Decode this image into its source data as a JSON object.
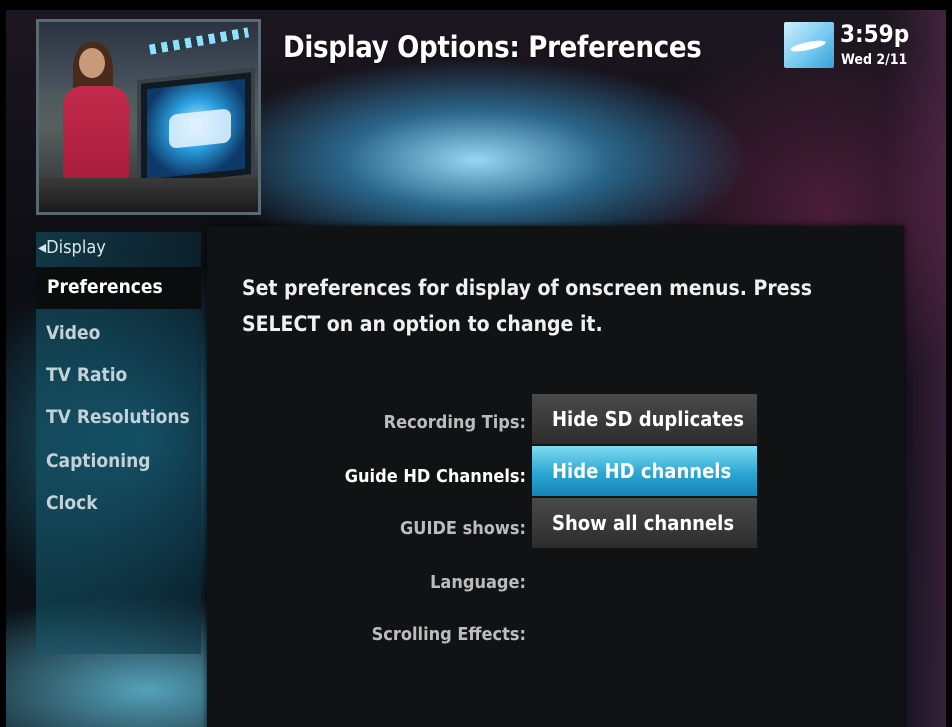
{
  "header": {
    "title": "Display Options: Preferences",
    "time": "3:59p",
    "date": "Wed 2/11"
  },
  "sidebar": {
    "back_label": "Display",
    "items": [
      {
        "label": "Preferences",
        "selected": true
      },
      {
        "label": "Video"
      },
      {
        "label": "TV Ratio"
      },
      {
        "label": "TV Resolutions"
      },
      {
        "label": "Captioning"
      },
      {
        "label": "Clock"
      }
    ]
  },
  "main": {
    "intro": "Set preferences for display of onscreen menus. Press SELECT on an option to change it.",
    "options": [
      {
        "label": "Recording Tips:",
        "value": "Hide SD duplicates"
      },
      {
        "label": "Guide HD Channels:",
        "value": "Hide HD channels",
        "focused": true
      },
      {
        "label": "GUIDE shows:",
        "value": "Show all channels"
      },
      {
        "label": "Language:",
        "value": ""
      },
      {
        "label": "Scrolling Effects:",
        "value": ""
      }
    ]
  },
  "colors": {
    "highlight": "#2aa6d2",
    "panel": "#111213",
    "accent_glow": "#6ec6ef"
  },
  "icons": {
    "brand": "provider-logo-icon",
    "back": "back-arrow-icon"
  }
}
